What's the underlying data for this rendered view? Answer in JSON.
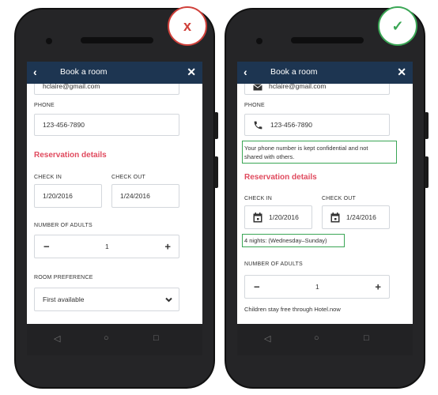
{
  "badges": {
    "wrong": "x",
    "right": "✓"
  },
  "left_phone": {
    "header": {
      "back": "‹",
      "title": "Book a room",
      "close": "✕"
    },
    "email": {
      "value": "hclaire@gmail.com"
    },
    "phone": {
      "label": "PHONE",
      "value": "123-456-7890"
    },
    "reservation": {
      "heading": "Reservation details"
    },
    "check_in": {
      "label": "CHECK IN",
      "value": "1/20/2016"
    },
    "check_out": {
      "label": "CHECK OUT",
      "value": "1/24/2016"
    },
    "adults": {
      "label": "NUMBER OF ADULTS",
      "minus": "−",
      "value": "1",
      "plus": "+"
    },
    "room_pref": {
      "label": "ROOM PREFERENCE",
      "value": "First available",
      "chevron": "⌄"
    },
    "nav": {
      "back": "◁",
      "home": "○",
      "recent": "□"
    }
  },
  "right_phone": {
    "header": {
      "back": "‹",
      "title": "Book a room",
      "close": "✕"
    },
    "email": {
      "value": "hclaire@gmail.com"
    },
    "phone": {
      "label": "PHONE",
      "value": "123-456-7890"
    },
    "phone_note": {
      "line1": "Your phone number is kept confidential and not",
      "line2": "shared with others."
    },
    "reservation": {
      "heading": "Reservation details"
    },
    "check_in": {
      "label": "CHECK IN",
      "value": "1/20/2016"
    },
    "check_out": {
      "label": "CHECK OUT",
      "value": "1/24/2016"
    },
    "nights": {
      "text": "4 nights: (Wednesday–Sunday)"
    },
    "adults": {
      "label": "NUMBER OF ADULTS",
      "minus": "−",
      "value": "1",
      "plus": "+"
    },
    "children_note": {
      "text": "Children stay free through Hotel.now"
    },
    "nav": {
      "back": "◁",
      "home": "○",
      "recent": "□"
    }
  },
  "colors": {
    "appbar": "#1d3551",
    "accent": "#e04a5e",
    "good": "#3aa655",
    "bad": "#d0403a"
  }
}
